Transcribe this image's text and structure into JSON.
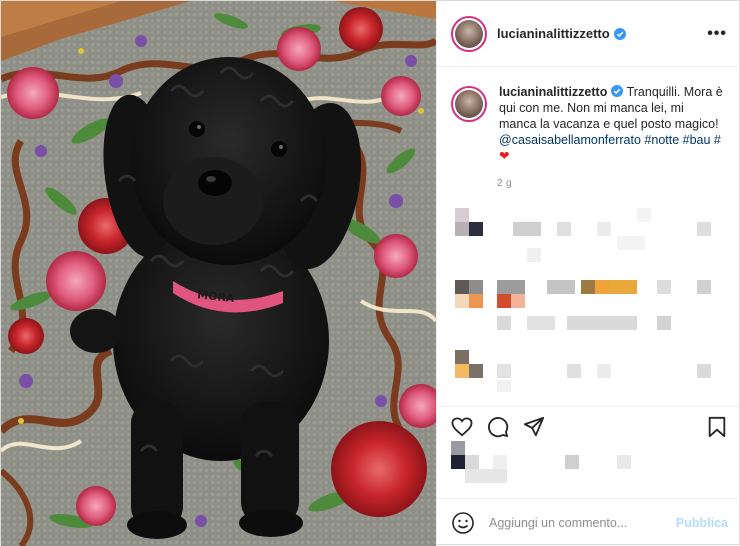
{
  "post": {
    "username": "lucianinalittizzetto",
    "more_label": "•••",
    "caption": {
      "username": "lucianinalittizzetto",
      "text": "Tranquilli. Mora è qui con me. Non mi manca lei, mi manca la vacanza e quel posto magico!",
      "mention": "@casaisabellamonferrato",
      "hashtags": "#notte #bau #",
      "emoji": "❤"
    },
    "time": "2 g",
    "collar_text": "MORA",
    "comment_placeholder": "Aggiungi un commento...",
    "publish_label": "Pubblica"
  },
  "icons": {
    "verified": "verified-badge-icon",
    "like": "heart-icon",
    "comment": "comment-bubble-icon",
    "share": "paper-plane-icon",
    "save": "bookmark-icon",
    "emoji": "smiley-icon",
    "more": "more-options-icon"
  },
  "colors": {
    "verified_blue": "#3897f0",
    "link_blue": "#00376b",
    "publish_disabled": "#b3dbff",
    "avatar_ring": "#d92e7f"
  }
}
